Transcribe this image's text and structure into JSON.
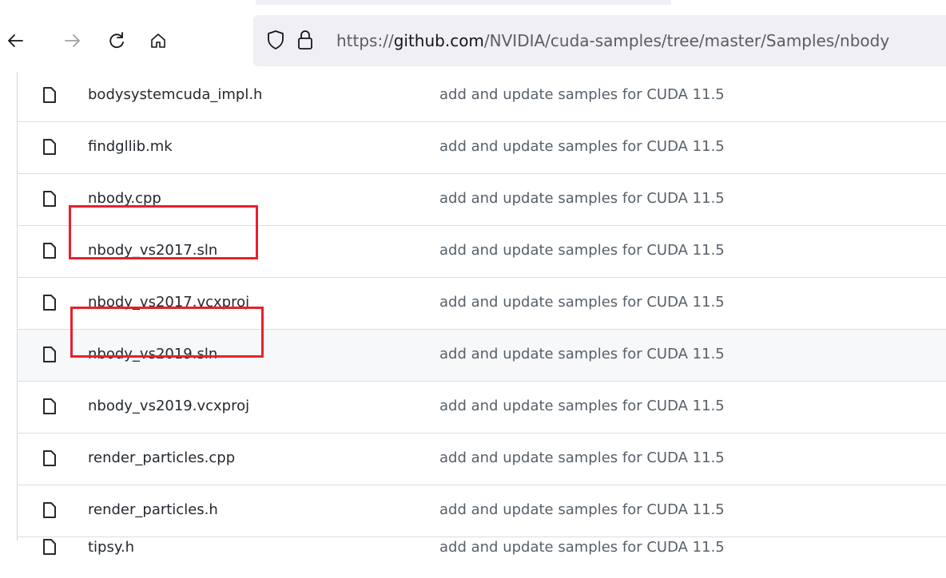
{
  "browser": {
    "url_prefix": "https://",
    "url_domain": "github.com",
    "url_path": "/NVIDIA/cuda-samples/tree/master/Samples/nbody"
  },
  "files": [
    {
      "name": "bodysystemcuda_impl.h",
      "commit": "add and update samples for CUDA 11.5"
    },
    {
      "name": "findgllib.mk",
      "commit": "add and update samples for CUDA 11.5"
    },
    {
      "name": "nbody.cpp",
      "commit": "add and update samples for CUDA 11.5"
    },
    {
      "name": "nbody_vs2017.sln",
      "commit": "add and update samples for CUDA 11.5"
    },
    {
      "name": "nbody_vs2017.vcxproj",
      "commit": "add and update samples for CUDA 11.5"
    },
    {
      "name": "nbody_vs2019.sln",
      "commit": "add and update samples for CUDA 11.5"
    },
    {
      "name": "nbody_vs2019.vcxproj",
      "commit": "add and update samples for CUDA 11.5"
    },
    {
      "name": "render_particles.cpp",
      "commit": "add and update samples for CUDA 11.5"
    },
    {
      "name": "render_particles.h",
      "commit": "add and update samples for CUDA 11.5"
    },
    {
      "name": "tipsy.h",
      "commit": "add and update samples for CUDA 11.5"
    }
  ],
  "colors": {
    "annotation": "#e8212b",
    "hover_row": "#f6f8fa"
  },
  "icons": {
    "back": "arrow-left-icon",
    "forward": "arrow-right-icon",
    "reload": "reload-icon",
    "home": "home-icon",
    "tracking": "shield-icon",
    "secure": "lock-icon",
    "file": "file-icon"
  }
}
